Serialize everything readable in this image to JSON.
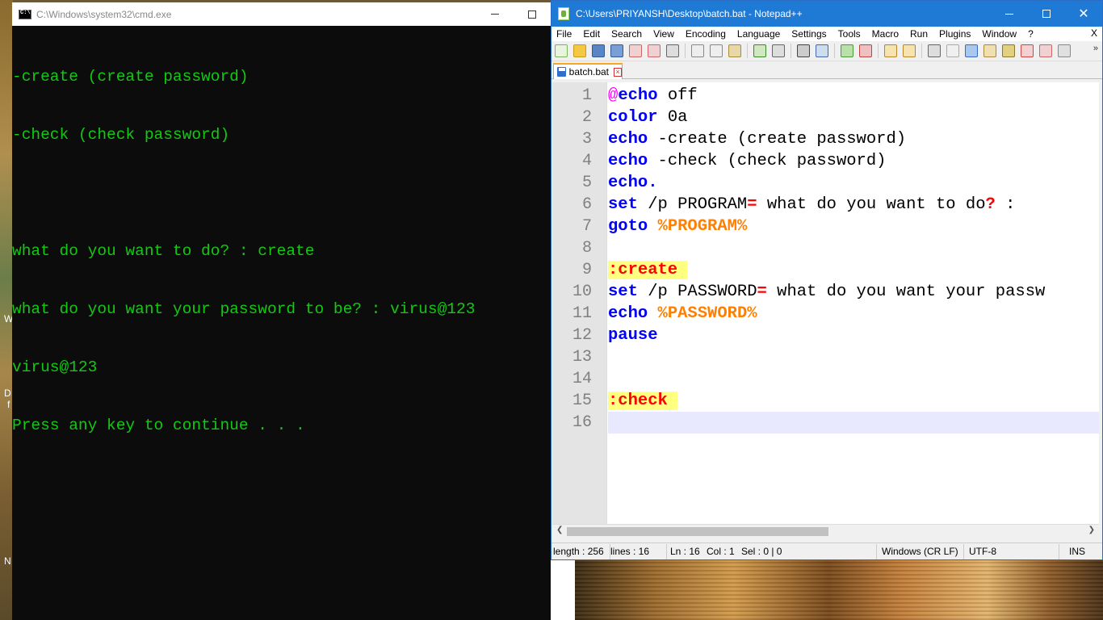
{
  "desktop": {
    "letters": [
      "W",
      "D",
      "f",
      "N"
    ]
  },
  "cmd": {
    "title": "C:\\Windows\\system32\\cmd.exe",
    "lines": [
      "-create (create password)",
      "-check (check password)",
      "",
      "what do you want to do? : create",
      "what do you want your password to be? : virus@123",
      "virus@123",
      "Press any key to continue . . ."
    ],
    "text_color": "#13c913"
  },
  "npp": {
    "title": "C:\\Users\\PRIYANSH\\Desktop\\batch.bat - Notepad++",
    "menu": [
      "File",
      "Edit",
      "Search",
      "View",
      "Encoding",
      "Language",
      "Settings",
      "Tools",
      "Macro",
      "Run",
      "Plugins",
      "Window",
      "?"
    ],
    "menu_close": "X",
    "tab_label": "batch.bat",
    "line_numbers": [
      "1",
      "2",
      "3",
      "4",
      "5",
      "6",
      "7",
      "8",
      "9",
      "10",
      "11",
      "12",
      "13",
      "14",
      "15",
      "16"
    ],
    "code": {
      "l1_at": "@",
      "l1_kw": "echo",
      "l1_rest": " off",
      "l2_kw": "color",
      "l2_rest": " 0a",
      "l3_kw": "echo",
      "l3_rest": " -create (create password)",
      "l4_kw": "echo",
      "l4_rest": " -check (check password)",
      "l5_kw": "echo.",
      "l6_kw": "set",
      "l6_a": " /p PROGRAM",
      "l6_op": "=",
      "l6_b": " what do you want to do",
      "l6_q": "?",
      "l6_c": " :",
      "l7_kw": "goto",
      "l7_sp": " ",
      "l7_var": "%PROGRAM%",
      "l9_label": ":create",
      "l10_kw": "set",
      "l10_a": " /p PASSWORD",
      "l10_op": "=",
      "l10_b": " what do you want your passw",
      "l11_kw": "echo",
      "l11_sp": " ",
      "l11_var": "%PASSWORD%",
      "l12_kw": "pause",
      "l15_label": ":check"
    },
    "status": {
      "length": "length : 256",
      "lines": "lines : 16",
      "ln": "Ln : 16",
      "col": "Col : 1",
      "sel": "Sel : 0 | 0",
      "eol": "Windows (CR LF)",
      "encoding": "UTF-8",
      "mode": "INS"
    },
    "colors": {
      "keyword": "#0000ff",
      "variable": "#ff8000",
      "operator": "#ff0000",
      "label_bg": "#ffff80",
      "title_bar": "#1f7ad6"
    }
  }
}
